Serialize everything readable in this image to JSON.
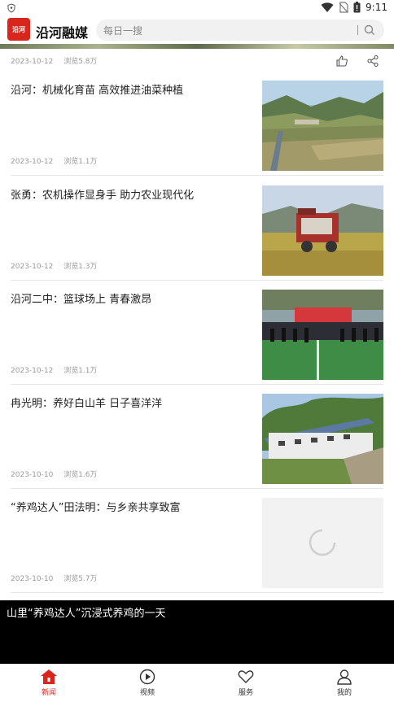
{
  "status": {
    "time": "9:11"
  },
  "header": {
    "logo_text": "沿河",
    "app_title": "沿河融媒",
    "search_placeholder": "每日一搜"
  },
  "top_meta": {
    "date": "2023-10-12",
    "views": "浏览5.8万"
  },
  "items": [
    {
      "title": "沿河：机械化育苗 高效推进油菜种植",
      "date": "2023-10-12",
      "views": "浏览1.1万"
    },
    {
      "title": "张勇：农机操作显身手 助力农业现代化",
      "date": "2023-10-12",
      "views": "浏览1.3万"
    },
    {
      "title": "沿河二中：篮球场上 青春激昂",
      "date": "2023-10-12",
      "views": "浏览1.1万"
    },
    {
      "title": "冉光明：养好白山羊 日子喜洋洋",
      "date": "2023-10-10",
      "views": "浏览1.6万"
    },
    {
      "title": "“养鸡达人”田法明：与乡亲共享致富",
      "date": "2023-10-10",
      "views": "浏览5.7万"
    }
  ],
  "video": {
    "title": "山里“养鸡达人”沉浸式养鸡的一天"
  },
  "tabs": [
    {
      "label": "新闻",
      "icon": "home-icon"
    },
    {
      "label": "视频",
      "icon": "play-icon"
    },
    {
      "label": "服务",
      "icon": "heart-icon"
    },
    {
      "label": "我的",
      "icon": "user-icon"
    }
  ],
  "colors": {
    "accent": "#d9261c"
  }
}
